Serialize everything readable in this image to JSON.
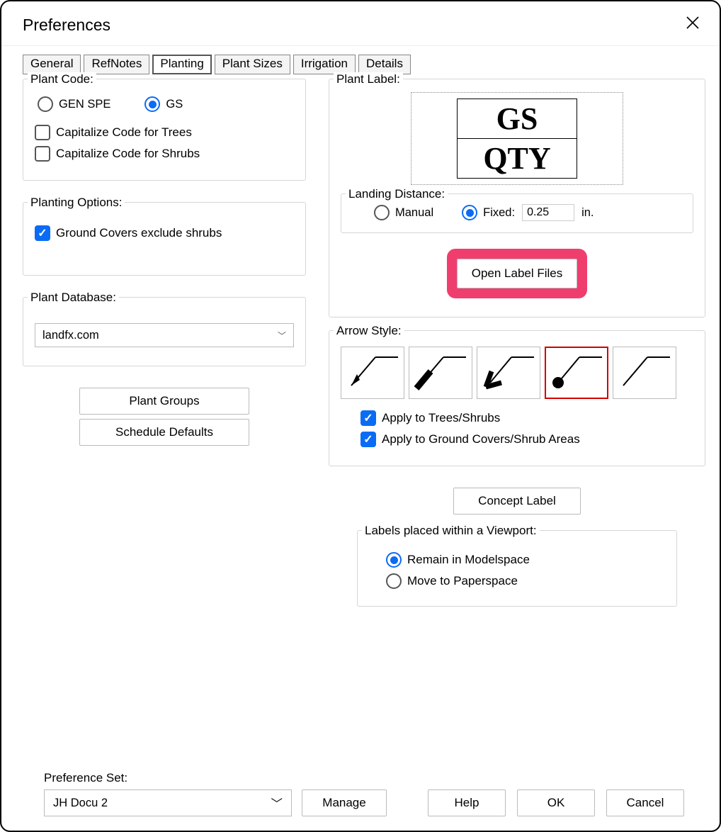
{
  "title": "Preferences",
  "tabs": [
    "General",
    "RefNotes",
    "Planting",
    "Plant Sizes",
    "Irrigation",
    "Details"
  ],
  "active_tab_index": 2,
  "plant_code": {
    "title": "Plant Code:",
    "radio1": "GEN SPE",
    "radio2": "GS",
    "selected": "GS",
    "cap_trees": "Capitalize Code for Trees",
    "cap_shrubs": "Capitalize Code for Shrubs"
  },
  "planting_options": {
    "title": "Planting Options:",
    "gc_exclude": "Ground Covers exclude shrubs"
  },
  "plant_db": {
    "title": "Plant Database:",
    "value": "landfx.com"
  },
  "buttons_left": {
    "groups": "Plant Groups",
    "schedule": "Schedule Defaults"
  },
  "plant_label": {
    "title": "Plant Label:",
    "row1": "GS",
    "row2": "QTY"
  },
  "landing": {
    "title": "Landing Distance:",
    "manual": "Manual",
    "fixed": "Fixed:",
    "value": "0.25",
    "unit": "in."
  },
  "open_label_files": "Open Label Files",
  "arrow": {
    "title": "Arrow Style:",
    "apply_trees": "Apply to Trees/Shrubs",
    "apply_gc": "Apply to Ground Covers/Shrub Areas",
    "selected_index": 3
  },
  "concept_label": "Concept Label",
  "viewport": {
    "title": "Labels placed within a Viewport:",
    "model": "Remain in Modelspace",
    "paper": "Move to Paperspace"
  },
  "pref_set": {
    "label": "Preference Set:",
    "value": "JH Docu 2",
    "manage": "Manage"
  },
  "footer": {
    "help": "Help",
    "ok": "OK",
    "cancel": "Cancel"
  }
}
